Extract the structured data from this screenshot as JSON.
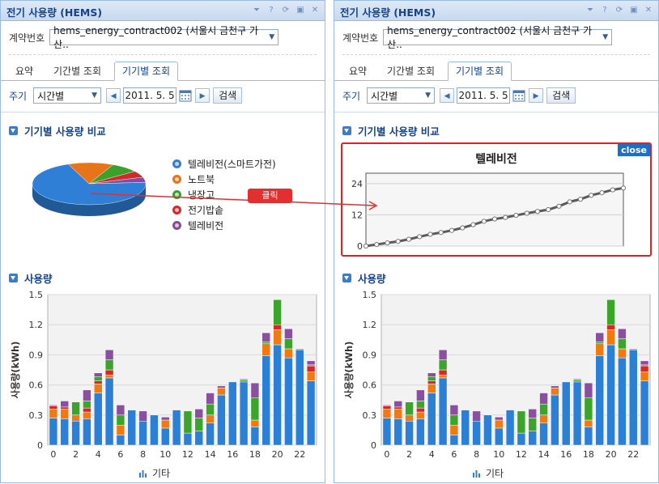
{
  "window": {
    "title": "전기 사용량 (HEMS)",
    "tools": [
      "collapse",
      "help",
      "refresh",
      "maximize",
      "close"
    ]
  },
  "contract": {
    "label": "계약번호",
    "value": "hems_energy_contract002 (서울시 금천구 가산.."
  },
  "tabs": [
    {
      "label": "요약"
    },
    {
      "label": "기간별 조회"
    },
    {
      "label": "기기별 조회",
      "active": true
    }
  ],
  "period": {
    "label": "주기",
    "select_value": "시간별",
    "date": "2011. 5. 5",
    "search_label": "검색"
  },
  "device_section": {
    "title": "기기별 사용량 비교"
  },
  "usage_section": {
    "title": "사용량"
  },
  "pie": {
    "slices": [
      {
        "name": "텔레비전(스마트가전)",
        "color": "#2f7fd6",
        "value": 70
      },
      {
        "name": "노트북",
        "color": "#e8741a",
        "value": 13
      },
      {
        "name": "냉장고",
        "color": "#3aa22a",
        "value": 8
      },
      {
        "name": "전기밥솥",
        "color": "#d02a2a",
        "value": 5
      },
      {
        "name": "텔레비전",
        "color": "#8a4a9a",
        "value": 4
      }
    ]
  },
  "click_label": "클릭",
  "popup": {
    "title": "텔레비전",
    "close_label": "close",
    "chart_data": {
      "type": "line",
      "yticks": [
        "24",
        "12",
        "0"
      ],
      "ylim": [
        0,
        28
      ],
      "values": [
        0,
        0.6,
        1.2,
        1.8,
        2.6,
        3.6,
        4.5,
        5.2,
        6,
        7,
        8.2,
        9.5,
        10.4,
        11,
        11.8,
        12.6,
        13.3,
        14,
        15.3,
        17,
        18,
        19.5,
        20.5,
        21.6,
        22.3
      ]
    }
  },
  "chart_data": {
    "type": "bar",
    "stacked": true,
    "ylabel": "사용량(kWh)",
    "ylim": [
      0,
      1.5
    ],
    "yticks": [
      "0",
      "0.3",
      "0.6",
      "0.9",
      "1.2",
      "1.5"
    ],
    "xticks": [
      "0",
      "2",
      "4",
      "6",
      "8",
      "10",
      "12",
      "14",
      "16",
      "18",
      "20",
      "22"
    ],
    "legend": "기타",
    "categories": [
      "0",
      "1",
      "2",
      "3",
      "4",
      "5",
      "6",
      "7",
      "8",
      "9",
      "10",
      "11",
      "12",
      "13",
      "14",
      "15",
      "16",
      "17",
      "18",
      "19",
      "20",
      "21",
      "22",
      "23"
    ],
    "series": [
      {
        "color": "#2b7fd4",
        "values": [
          0.27,
          0.26,
          0.24,
          0.26,
          0.52,
          0.67,
          0.1,
          0.35,
          0.24,
          0.3,
          0.17,
          0.35,
          0.12,
          0.14,
          0.22,
          0.5,
          0.63,
          0.63,
          0.18,
          0.89,
          1.0,
          0.87,
          0.95,
          0.64
        ]
      },
      {
        "color": "#f07a12",
        "values": [
          0.09,
          0.1,
          0.06,
          0.07,
          0.09,
          0.03,
          0.1,
          0.0,
          0.0,
          0.0,
          0.08,
          0.0,
          0.0,
          0.0,
          0.08,
          0.07,
          0.0,
          0.0,
          0.07,
          0.12,
          0.15,
          0.09,
          0.01,
          0.09
        ]
      },
      {
        "color": "#d62828",
        "values": [
          0.03,
          0.02,
          0.0,
          0.04,
          0.03,
          0.05,
          0.0,
          0.0,
          0.0,
          0.0,
          0.0,
          0.0,
          0.0,
          0.0,
          0.0,
          0.0,
          0.0,
          0.0,
          0.0,
          0.0,
          0.05,
          0.0,
          0.0,
          0.06
        ]
      },
      {
        "color": "#3aa52a",
        "values": [
          0.0,
          0.0,
          0.13,
          0.07,
          0.04,
          0.1,
          0.1,
          0.0,
          0.0,
          0.0,
          0.0,
          0.0,
          0.22,
          0.13,
          0.11,
          0.0,
          0.0,
          0.02,
          0.22,
          0.02,
          0.25,
          0.1,
          0.0,
          0.01
        ]
      },
      {
        "color": "#8a4f9e",
        "values": [
          0.01,
          0.06,
          0.0,
          0.11,
          0.04,
          0.1,
          0.1,
          0.0,
          0.1,
          0.0,
          0.03,
          0.0,
          0.0,
          0.09,
          0.11,
          0.02,
          0.0,
          0.01,
          0.15,
          0.09,
          0.0,
          0.1,
          0.0,
          0.04
        ]
      }
    ]
  }
}
